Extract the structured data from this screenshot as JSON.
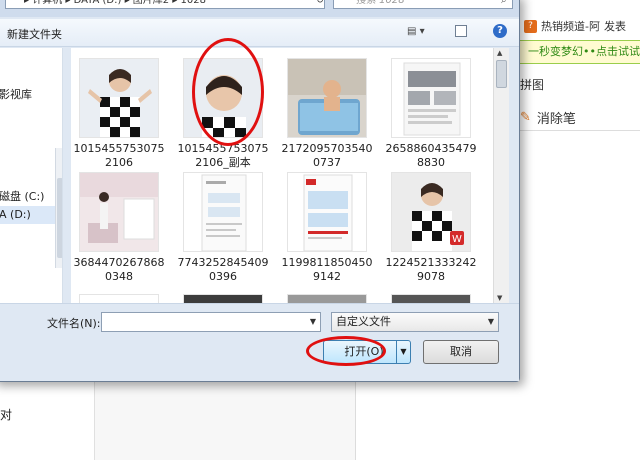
{
  "address": {
    "path": "▸ 计算机 ▸ DATA (D:) ▸ 图片库2 ▸ 1028",
    "search_placeholder": "搜索 1028"
  },
  "toolbar": {
    "new_folder": "新建文件夹"
  },
  "nav": {
    "items": [
      "影视库",
      "磁盘 (C:)",
      "A (D:)"
    ]
  },
  "files": [
    {
      "name": "10154557530752106",
      "kind": "portrait"
    },
    {
      "name": "10154557530752106_副本",
      "kind": "portrait-crop"
    },
    {
      "name": "21720957035400737",
      "kind": "child-bath"
    },
    {
      "name": "26588604354798830",
      "kind": "flyer-room"
    },
    {
      "name": "36844702678680348",
      "kind": "room"
    },
    {
      "name": "77432528454090396",
      "kind": "document"
    },
    {
      "name": "11998118504509142",
      "kind": "flyer-red"
    },
    {
      "name": "12245213332429078",
      "kind": "portrait-logo"
    }
  ],
  "bottom": {
    "filename_label": "文件名(N):",
    "filename_value": "",
    "filter": "自定义文件",
    "open": "打开(O)",
    "cancel": "取消"
  },
  "background": {
    "hot_channel": "热销频道-阿",
    "hot_extra": "发表",
    "promo": "一秒变梦幻••点击试试看",
    "tab": "拼图",
    "eraser": "消除笔",
    "bottom_left": "对"
  }
}
